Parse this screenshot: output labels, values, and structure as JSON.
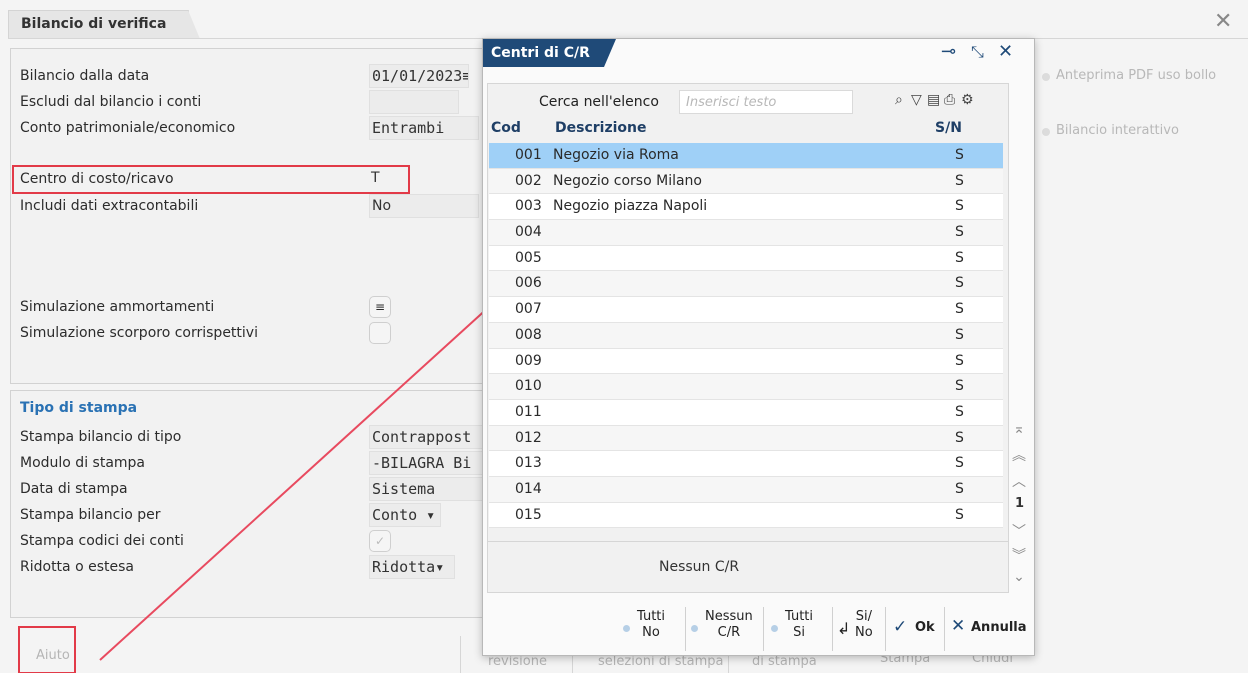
{
  "main": {
    "title": "Bilancio di verifica",
    "close_icon": "close-icon",
    "fields": [
      {
        "label": "Bilancio dalla data",
        "value": "01/01/2023≡"
      },
      {
        "label": "Escludi dal bilancio i conti",
        "value": ""
      },
      {
        "label": "Conto patrimoniale/economico",
        "value": "Entrambi"
      },
      {
        "label": "Centro di costo/ricavo",
        "value": "T"
      },
      {
        "label": "Includi dati extracontabili",
        "value": "No"
      },
      {
        "label": "Simulazione ammortamenti",
        "value": "≡"
      },
      {
        "label": "Simulazione scorporo corrispettivi",
        "value": ""
      }
    ],
    "stampa": {
      "title": "Tipo di stampa",
      "fields": [
        {
          "label": "Stampa bilancio di tipo",
          "value": "Contrappost"
        },
        {
          "label": "Modulo di stampa",
          "value": "-BILAGRA Bi"
        },
        {
          "label": "Data di stampa",
          "value": "Sistema"
        },
        {
          "label": "Stampa bilancio per",
          "value": "Conto ▾"
        },
        {
          "label": "Stampa codici dei conti",
          "value": "✓"
        },
        {
          "label": "Ridotta o estesa",
          "value": "Ridotta▾"
        }
      ]
    },
    "side_links": [
      "Anteprima PDF uso bollo",
      "Bilancio interattivo"
    ],
    "bottom": {
      "aiuto": "Aiuto",
      "revisione": "revisione",
      "selezioni": "selezioni di stampa",
      "di_stampa": "di stampa",
      "stampa": "Stampa",
      "chiudi": "Chiudi"
    }
  },
  "modal": {
    "title": "Centri di C/R",
    "search_label": "Cerca nell'elenco",
    "search_placeholder": "Inserisci testo",
    "columns": {
      "cod": "Cod",
      "desc": "Descrizione",
      "sn": "S/N"
    },
    "rows": [
      {
        "cod": "001",
        "desc": "Negozio via Roma",
        "sn": "S"
      },
      {
        "cod": "002",
        "desc": "Negozio corso Milano",
        "sn": "S"
      },
      {
        "cod": "003",
        "desc": "Negozio piazza Napoli",
        "sn": "S"
      },
      {
        "cod": "004",
        "desc": "",
        "sn": "S"
      },
      {
        "cod": "005",
        "desc": "",
        "sn": "S"
      },
      {
        "cod": "006",
        "desc": "",
        "sn": "S"
      },
      {
        "cod": "007",
        "desc": "",
        "sn": "S"
      },
      {
        "cod": "008",
        "desc": "",
        "sn": "S"
      },
      {
        "cod": "009",
        "desc": "",
        "sn": "S"
      },
      {
        "cod": "010",
        "desc": "",
        "sn": "S"
      },
      {
        "cod": "011",
        "desc": "",
        "sn": "S"
      },
      {
        "cod": "012",
        "desc": "",
        "sn": "S"
      },
      {
        "cod": "013",
        "desc": "",
        "sn": "S"
      },
      {
        "cod": "014",
        "desc": "",
        "sn": "S"
      },
      {
        "cod": "015",
        "desc": "",
        "sn": "S"
      }
    ],
    "page": "1",
    "nessun": "Nessun C/R",
    "buttons": {
      "tutti_no": [
        "Tutti",
        "No"
      ],
      "nessun_cr": [
        "Nessun",
        "C/R"
      ],
      "tutti_si": [
        "Tutti",
        "Si"
      ],
      "si_no": [
        "Si/",
        "No"
      ],
      "ok": "Ok",
      "annulla": "Annulla"
    }
  },
  "colors": {
    "accent": "#1f4a78",
    "highlight": "#e23a48",
    "selected_row": "#9fd0f7",
    "section_title": "#2a72b4"
  }
}
